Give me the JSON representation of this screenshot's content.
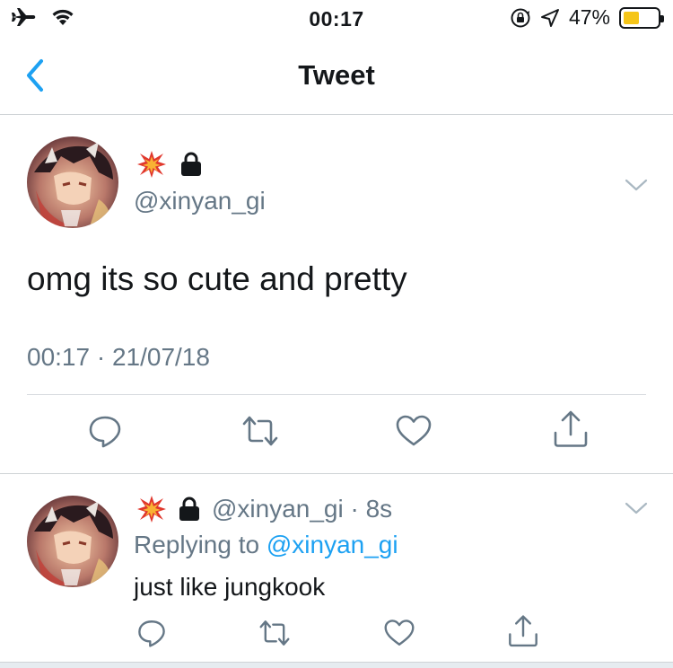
{
  "status_bar": {
    "time": "00:17",
    "battery_percent": "47%",
    "battery_level": 0.47,
    "left_icons": [
      "airplane-icon",
      "wifi-icon"
    ],
    "right_icons": [
      "rotation-lock-icon",
      "location-arrow-icon",
      "battery-icon"
    ]
  },
  "nav": {
    "title": "Tweet",
    "back_icon": "chevron-left-icon"
  },
  "tweet": {
    "emoji_name": "collision-icon",
    "protected_icon": "lock-icon",
    "handle": "@xinyan_gi",
    "text": "omg its so cute and pretty",
    "timestamp": "00:17 · 21/07/18",
    "actions": [
      "reply-icon",
      "retweet-icon",
      "like-icon",
      "share-icon"
    ]
  },
  "reply": {
    "handle_time": "@xinyan_gi · 8s",
    "replying_prefix": "Replying to ",
    "replying_to": "@xinyan_gi",
    "text": "just like jungkook",
    "actions": [
      "reply-icon",
      "retweet-icon",
      "like-icon",
      "share-icon"
    ]
  },
  "colors": {
    "accent": "#1da1f2",
    "secondary_text": "#657786",
    "primary_text": "#14171a",
    "battery_fill": "#f5c518"
  }
}
